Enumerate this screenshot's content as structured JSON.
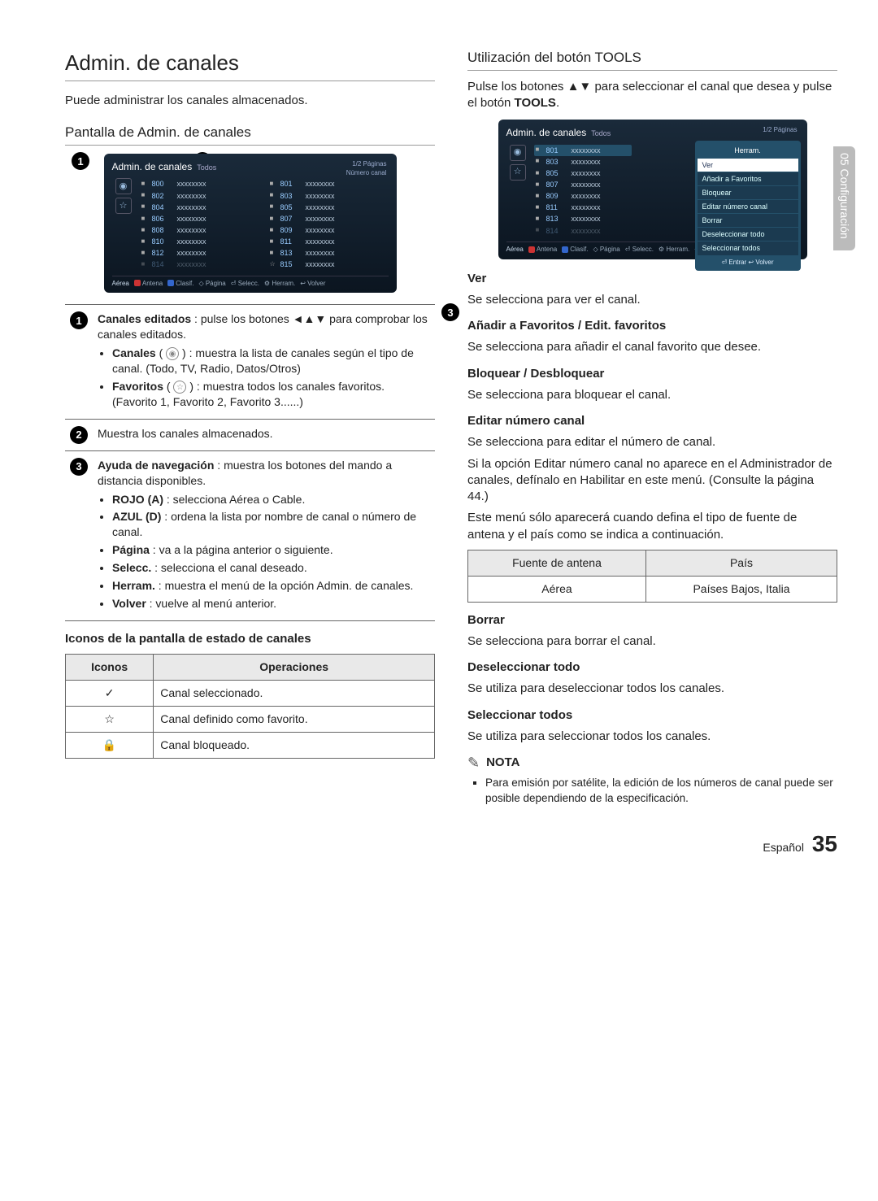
{
  "sideTab": "05  Configuración",
  "left": {
    "h1": "Admin. de canales",
    "intro": "Puede administrar los canales almacenados.",
    "h2": "Pantalla de Admin. de canales",
    "callout1": "1",
    "callout2": "2",
    "callout3": "3",
    "tv": {
      "title": "Admin. de canales",
      "subtitle": "Todos",
      "meta1": "1/2 Páginas",
      "meta2": "Número canal",
      "rowsL": [
        {
          "n": "800",
          "t": "xxxxxxxx",
          "m": "■"
        },
        {
          "n": "802",
          "t": "xxxxxxxx",
          "m": "■"
        },
        {
          "n": "804",
          "t": "xxxxxxxx",
          "m": "■"
        },
        {
          "n": "806",
          "t": "xxxxxxxx",
          "m": "■"
        },
        {
          "n": "808",
          "t": "xxxxxxxx",
          "m": "■"
        },
        {
          "n": "810",
          "t": "xxxxxxxx",
          "m": "■"
        },
        {
          "n": "812",
          "t": "xxxxxxxx",
          "m": "■"
        },
        {
          "n": "814",
          "t": "xxxxxxxx",
          "m": "■",
          "dim": true
        }
      ],
      "rowsR": [
        {
          "n": "801",
          "t": "xxxxxxxx",
          "m": "■"
        },
        {
          "n": "803",
          "t": "xxxxxxxx",
          "m": "■"
        },
        {
          "n": "805",
          "t": "xxxxxxxx",
          "m": "■"
        },
        {
          "n": "807",
          "t": "xxxxxxxx",
          "m": "■"
        },
        {
          "n": "809",
          "t": "xxxxxxxx",
          "m": "■"
        },
        {
          "n": "811",
          "t": "xxxxxxxx",
          "m": "■"
        },
        {
          "n": "813",
          "t": "xxxxxxxx",
          "m": "■"
        },
        {
          "n": "815",
          "t": "xxxxxxxx",
          "m": "■",
          "star": true
        }
      ],
      "bottom": {
        "aerea": "Aérea",
        "antena": "Antena",
        "clasif": "Clasif.",
        "pagina": "Página",
        "selecc": "Selecc.",
        "herram": "Herram.",
        "volver": "Volver"
      }
    },
    "desc": {
      "r1a": "Canales editados",
      "r1b": " : pulse los botones ◄▲▼ para comprobar los canales editados.",
      "r1c1a": "Canales",
      "r1c1b": " : muestra la lista de canales según el tipo de canal. (Todo, TV, Radio, Datos/Otros)",
      "r1c2a": "Favoritos",
      "r1c2b": " : muestra todos los canales favoritos. (Favorito 1, Favorito 2, Favorito 3......)",
      "r2": "Muestra los canales almacenados.",
      "r3a": "Ayuda de navegación",
      "r3b": " : muestra los botones del mando a distancia disponibles.",
      "r3l1a": "ROJO (A)",
      "r3l1b": " : selecciona Aérea o Cable.",
      "r3l2a": "AZUL (D)",
      "r3l2b": " : ordena la lista por nombre de canal o número de canal.",
      "r3l3a": "Página",
      "r3l3b": " : va a la página anterior o siguiente.",
      "r3l4a": "Selecc.",
      "r3l4b": " : selecciona el canal deseado.",
      "r3l5a": "Herram.",
      "r3l5b": " : muestra el menú de la opción Admin. de canales.",
      "r3l6a": "Volver",
      "r3l6b": " : vuelve al menú anterior."
    },
    "iconsHeading": "Iconos de la pantalla de estado de canales",
    "iconsTable": {
      "h1": "Iconos",
      "h2": "Operaciones",
      "r1": "Canal seleccionado.",
      "r2": "Canal definido como favorito.",
      "r3": "Canal bloqueado."
    }
  },
  "right": {
    "h2": "Utilización del botón TOOLS",
    "intro1": "Pulse los botones ▲▼ para seleccionar el canal que desea y pulse el botón ",
    "intro2": "TOOLS",
    "intro3": ".",
    "tv": {
      "title": "Admin. de canales",
      "subtitle": "Todos",
      "meta1": "1/2 Páginas",
      "panelTitle": "Herram.",
      "rows": [
        {
          "n": "801",
          "t": "xxxxxxxx",
          "m": "■",
          "sel": true
        },
        {
          "n": "803",
          "t": "xxxxxxxx",
          "m": "■"
        },
        {
          "n": "805",
          "t": "xxxxxxxx",
          "m": "■"
        },
        {
          "n": "807",
          "t": "xxxxxxxx",
          "m": "■"
        },
        {
          "n": "809",
          "t": "xxxxxxxx",
          "m": "■"
        },
        {
          "n": "811",
          "t": "xxxxxxxx",
          "m": "■"
        },
        {
          "n": "813",
          "t": "xxxxxxxx",
          "m": "■"
        },
        {
          "n": "814",
          "t": "xxxxxxxx",
          "m": "■",
          "dim": true
        }
      ],
      "panel": [
        {
          "t": "Ver",
          "sel": true
        },
        {
          "t": "Añadir a Favoritos"
        },
        {
          "t": "Bloquear"
        },
        {
          "t": "Editar número canal"
        },
        {
          "t": "Borrar"
        },
        {
          "t": "Deseleccionar todo"
        },
        {
          "t": "Seleccionar todos"
        }
      ],
      "panelFooter": "⏎ Entrar   ↩ Volver",
      "bottom": {
        "aerea": "Aérea",
        "antena": "Antena",
        "clasif": "Clasif.",
        "pagina": "Página",
        "selecc": "Selecc.",
        "herram": "Herram.",
        "volver": "Volver"
      }
    },
    "sec": {
      "verH": "Ver",
      "verT": "Se selecciona para ver el canal.",
      "favH": "Añadir a Favoritos / Edit. favoritos",
      "favT": "Se selecciona para añadir el canal favorito que desee.",
      "bloqH": "Bloquear / Desbloquear",
      "bloqT": "Se selecciona para bloquear el canal.",
      "editH": "Editar número canal",
      "editT1": "Se selecciona para editar el número de canal.",
      "editT2": "Si la opción Editar número canal no aparece en el Administrador de canales, defínalo en Habilitar en este menú. (Consulte la página 44.)",
      "editT3": "Este menú sólo aparecerá cuando defina el tipo de fuente de antena y el país como se indica a continuación.",
      "tbl": {
        "h1": "Fuente de antena",
        "h2": "País",
        "c1": "Aérea",
        "c2": "Países Bajos, Italia"
      },
      "borH": "Borrar",
      "borT": "Se selecciona para borrar el canal.",
      "desH": "Deseleccionar todo",
      "desT": "Se utiliza para deseleccionar todos los canales.",
      "selH": "Seleccionar todos",
      "selT": "Se utiliza para seleccionar todos los canales.",
      "nota": "NOTA",
      "notaLi": "Para emisión por satélite, la edición de los números de canal puede ser posible dependiendo de la especificación."
    }
  },
  "footer": {
    "lang": "Español",
    "page": "35"
  }
}
